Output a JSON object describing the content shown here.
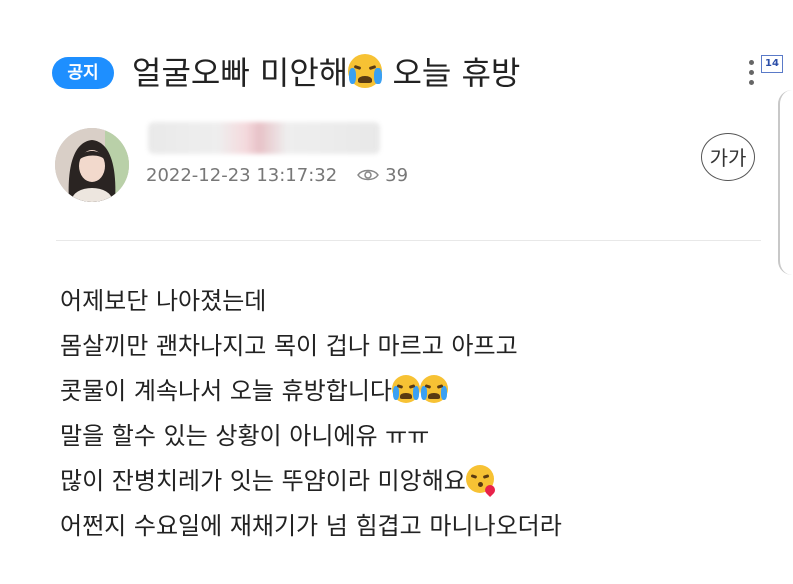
{
  "post": {
    "badge": "공지",
    "title": "얼굴오빠 미안해",
    "title_suffix": "오늘 휴방",
    "date": "2022-12-23 13:17:32",
    "views": "39",
    "font_button": "가가",
    "side_badge": "14"
  },
  "content": {
    "line1": "어제보단 나아졌는데",
    "line2": "몸살끼만 괜차나지고 목이 겁나 마르고 아프고",
    "line3": "콧물이 계속나서 오늘 휴방합니다",
    "line4": "말을 할수 있는 상황이 아니에유 ㅠㅠ",
    "line5": "많이 잔병치레가 잇는 뚜얌이라 미앙해요",
    "line6": "어쩐지 수요일에 재채기가 넘 힘겹고 마니나오더라"
  },
  "icons": {
    "crying_face": "loudly-crying-face-emoji",
    "kiss_face": "face-blowing-kiss-emoji",
    "views": "eye-icon",
    "more": "more-vertical-icon"
  },
  "colors": {
    "badge": "#1e8fff",
    "text": "#222222",
    "meta": "#777777"
  }
}
